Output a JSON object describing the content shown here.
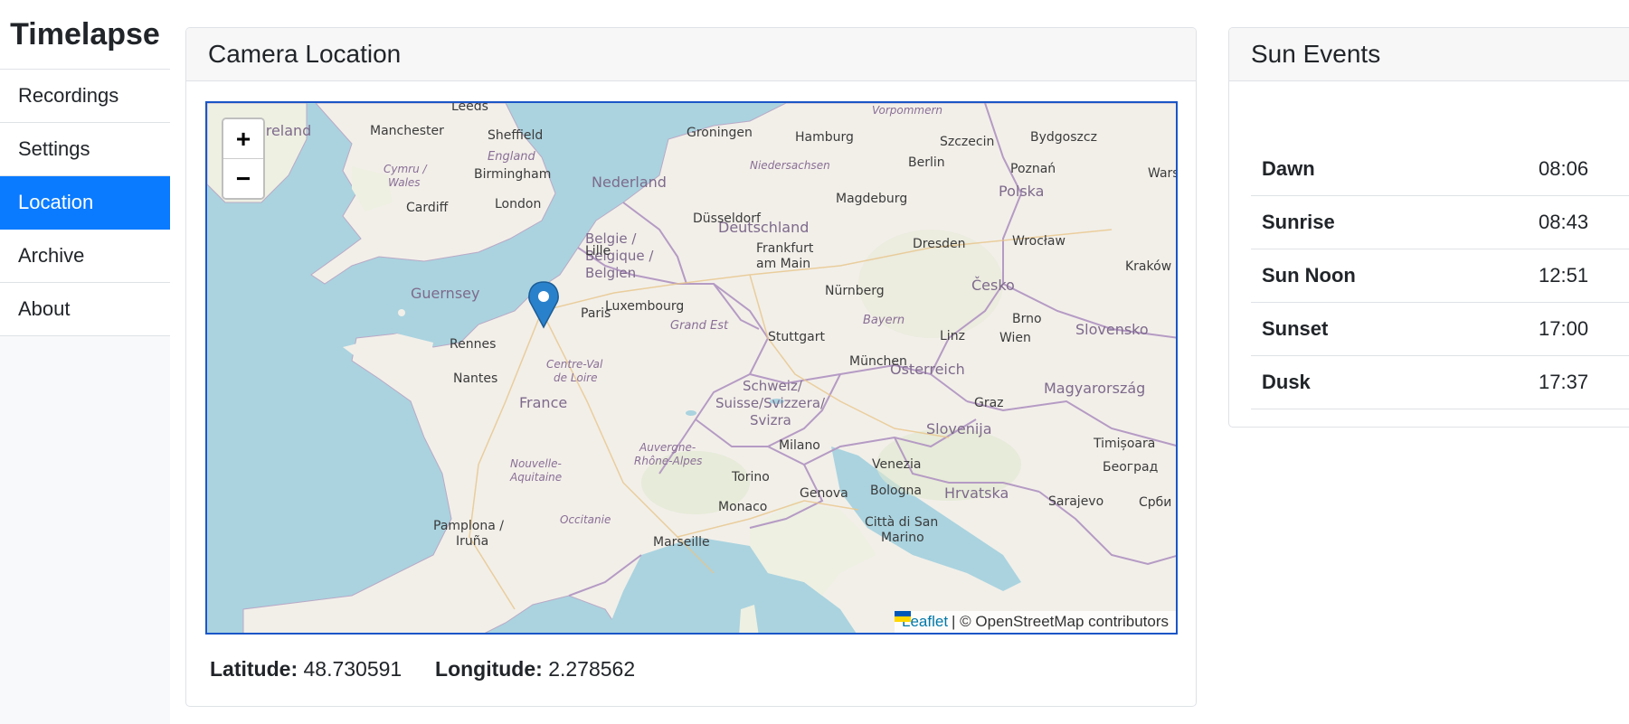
{
  "app": {
    "title": "Timelapse"
  },
  "sidebar": {
    "items": [
      {
        "label": "Recordings",
        "active": false
      },
      {
        "label": "Settings",
        "active": false
      },
      {
        "label": "Location",
        "active": true
      },
      {
        "label": "Archive",
        "active": false
      },
      {
        "label": "About",
        "active": false
      }
    ]
  },
  "location_card": {
    "title": "Camera Location",
    "map": {
      "zoom_in": "+",
      "zoom_out": "−",
      "attribution_link": "Leaflet",
      "attribution_text": "| © OpenStreetMap contributors",
      "marker_icon": "map-pin-icon",
      "labels": {
        "countries": [
          "Ireland",
          "Nederland",
          "Belgie / Belgique / Belgien",
          "Deutschland",
          "Polska",
          "France",
          "Česko",
          "Luxembourg",
          "Österreich",
          "Schweiz/ Suisse/Svizzera/ Svizra",
          "Slovenija",
          "Magyarország",
          "Hrvatska",
          "Slovensko",
          "Guernsey",
          "England",
          "Cymru / Wales"
        ],
        "cities": [
          "Leeds",
          "Manchester",
          "Sheffield",
          "Birmingham",
          "London",
          "Cardiff",
          "Groningen",
          "Hamburg",
          "Szczecin",
          "Bydgoszcz",
          "Berlin",
          "Poznań",
          "Warszaw",
          "Magdeburg",
          "Düsseldorf",
          "Lille",
          "Frankfurt am Main",
          "Dresden",
          "Wrocław",
          "Kraków",
          "Nürnberg",
          "Paris",
          "Rennes",
          "Nantes",
          "Stuttgart",
          "München",
          "Linz",
          "Wien",
          "Brno",
          "Graz",
          "Milano",
          "Venezia",
          "Torino",
          "Genova",
          "Bologna",
          "Monaco",
          "Marseille",
          "Pamplona / Iruña",
          "Sarajevo",
          "Timișoara",
          "Београд",
          "Срби",
          "Città di San Marino"
        ],
        "regions": [
          "Vorpommern",
          "Niedersachsen",
          "Bayern",
          "Grand Est",
          "Centre-Val de Loire",
          "Auvergne-Rhône-Alpes",
          "Nouvelle-Aquitaine",
          "Occitanie"
        ]
      }
    },
    "latitude_label": "Latitude:",
    "latitude_value": "48.730591",
    "longitude_label": "Longitude:",
    "longitude_value": "2.278562"
  },
  "sun_card": {
    "title": "Sun Events",
    "events": [
      {
        "name": "Dawn",
        "time": "08:06"
      },
      {
        "name": "Sunrise",
        "time": "08:43"
      },
      {
        "name": "Sun Noon",
        "time": "12:51"
      },
      {
        "name": "Sunset",
        "time": "17:00"
      },
      {
        "name": "Dusk",
        "time": "17:37"
      }
    ]
  },
  "colors": {
    "accent": "#0a7bff",
    "map_border": "#1a56c7",
    "marker": "#2a81cb"
  }
}
